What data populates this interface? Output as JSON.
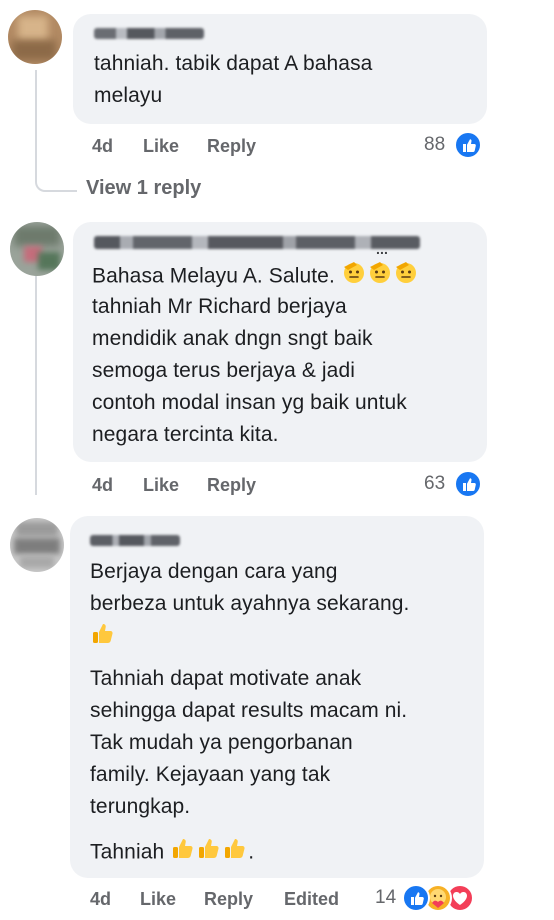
{
  "comments": [
    {
      "text_lines": [
        "tahniah. tabik dapat A bahasa",
        "melayu"
      ],
      "time": "4d",
      "like_label": "Like",
      "reply_label": "Reply",
      "reaction_count": "88",
      "view_replies": "View 1 reply"
    },
    {
      "name_fragment": "...",
      "text_lines": [
        "Bahasa Melayu A. Salute.",
        "tahniah Mr Richard berjaya",
        "mendidik anak dngn sngt baik",
        "semoga terus berjaya & jadi",
        "contoh modal insan yg baik untuk",
        "negara tercinta kita."
      ],
      "time": "4d",
      "like_label": "Like",
      "reply_label": "Reply",
      "reaction_count": "63"
    },
    {
      "text_lines": [
        "Berjaya dengan cara yang",
        "berbeza untuk ayahnya sekarang.",
        "",
        "Tahniah dapat motivate anak",
        "sehingga dapat results macam ni.",
        "Tak mudah ya pengorbanan",
        "family. Kejayaan yang tak",
        "terungkap.",
        "Tahniah",
        "."
      ],
      "time": "4d",
      "like_label": "Like",
      "reply_label": "Reply",
      "edited_label": "Edited",
      "reaction_count": "14"
    }
  ],
  "icons": [
    "like-reaction-icon",
    "care-reaction-icon",
    "love-reaction-icon",
    "saluting-face-emoji",
    "thumbs-up-emoji"
  ],
  "colors": {
    "bubble": "#f0f2f5",
    "meta": "#65676b",
    "like_blue": "#1877f2",
    "love_red": "#f33e58"
  }
}
